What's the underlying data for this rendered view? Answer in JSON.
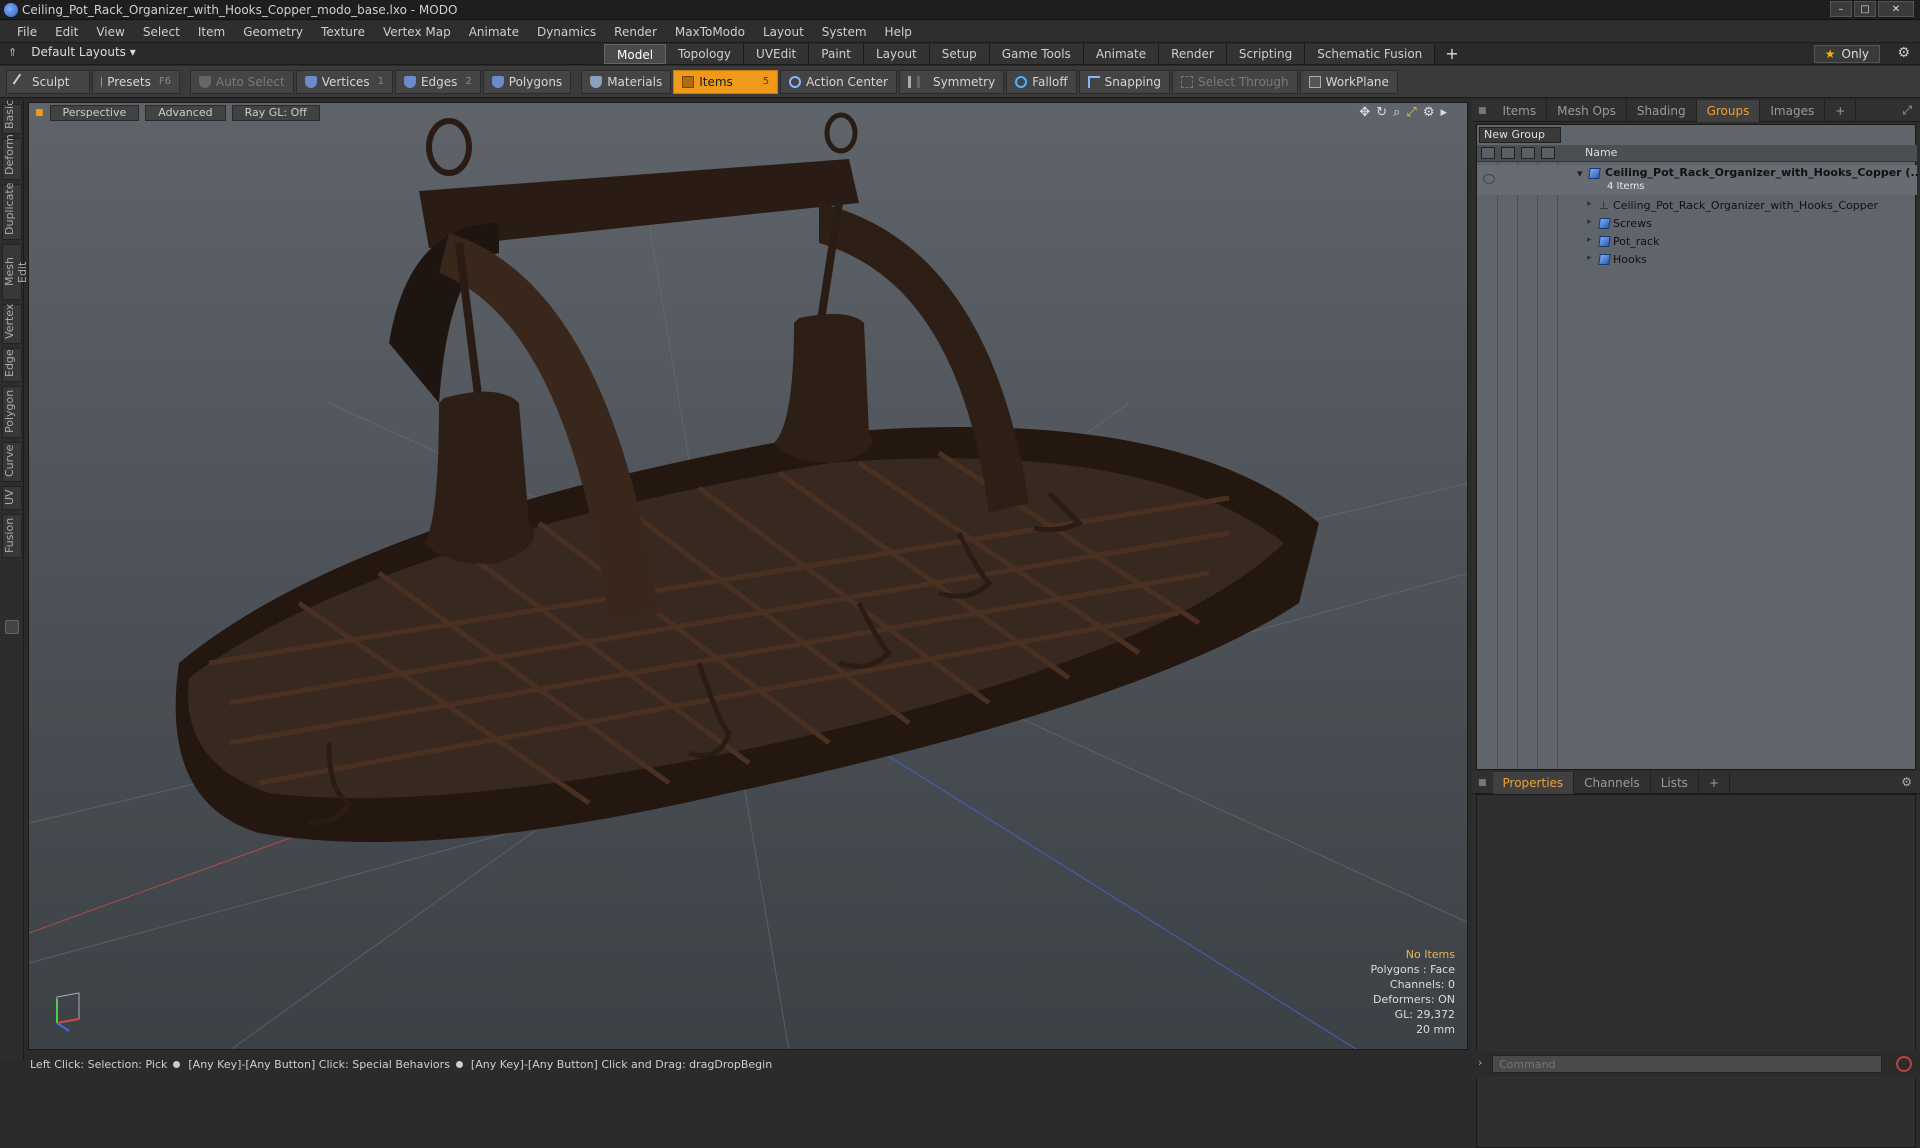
{
  "window": {
    "title": "Ceiling_Pot_Rack_Organizer_with_Hooks_Copper_modo_base.lxo - MODO",
    "controls": {
      "minimize": "–",
      "maximize": "□",
      "close": "✕"
    }
  },
  "menubar": {
    "items": [
      "File",
      "Edit",
      "View",
      "Select",
      "Item",
      "Geometry",
      "Texture",
      "Vertex Map",
      "Animate",
      "Dynamics",
      "Render",
      "MaxToModo",
      "Layout",
      "System",
      "Help"
    ]
  },
  "layoutbar": {
    "layouts_label": "Default Layouts ▾",
    "tabs": [
      "Model",
      "Topology",
      "UVEdit",
      "Paint",
      "Layout",
      "Setup",
      "Game Tools",
      "Animate",
      "Render",
      "Scripting",
      "Schematic Fusion"
    ],
    "active_tab": "Model",
    "add": "+",
    "only_label": "Only"
  },
  "toolbar": {
    "sculpt": "Sculpt",
    "presets": "Presets",
    "presets_key": "F6",
    "auto_select": "Auto Select",
    "vertices": "Vertices",
    "vertices_num": "1",
    "edges": "Edges",
    "edges_num": "2",
    "polygons": "Polygons",
    "materials": "Materials",
    "items": "Items",
    "items_num": "5",
    "action_center": "Action Center",
    "symmetry": "Symmetry",
    "falloff": "Falloff",
    "snapping": "Snapping",
    "select_through": "Select Through",
    "workplane": "WorkPlane"
  },
  "lefttabs": [
    "Basic",
    "Deform",
    "Duplicate",
    "Mesh Edit",
    "Vertex",
    "Edge",
    "Polygon",
    "Curve",
    "UV",
    "Fusion"
  ],
  "viewport": {
    "view": "Perspective",
    "shading": "Advanced",
    "raygl": "Ray GL: Off",
    "info": {
      "selection": "No Items",
      "polygons": "Polygons : Face",
      "channels": "Channels: 0",
      "deformers": "Deformers: ON",
      "gl": "GL: 29,372",
      "scale": "20 mm"
    }
  },
  "statusbar": {
    "part1": "Left Click: Selection: Pick",
    "part2": "[Any Key]-[Any Button] Click: Special Behaviors",
    "part3": "[Any Key]-[Any Button] Click and Drag: dragDropBegin"
  },
  "rightpanel": {
    "top_tabs": [
      "Items",
      "Mesh Ops",
      "Shading",
      "Groups",
      "Images"
    ],
    "active_top_tab": "Groups",
    "new_group": "New Group",
    "name_col": "Name",
    "tree": {
      "root": "Ceiling_Pot_Rack_Organizer_with_Hooks_Copper (...",
      "root_sub": "4 Items",
      "children": [
        "Ceiling_Pot_Rack_Organizer_with_Hooks_Copper",
        "Screws",
        "Pot_rack",
        "Hooks"
      ]
    },
    "bottom_tabs": [
      "Properties",
      "Channels",
      "Lists"
    ],
    "active_bottom_tab": "Properties",
    "command_placeholder": "Command"
  },
  "colors": {
    "accent": "#f09a1c",
    "copper": "#3a2418",
    "viewport_top": "#5e646a",
    "viewport_bottom": "#3c4146"
  }
}
